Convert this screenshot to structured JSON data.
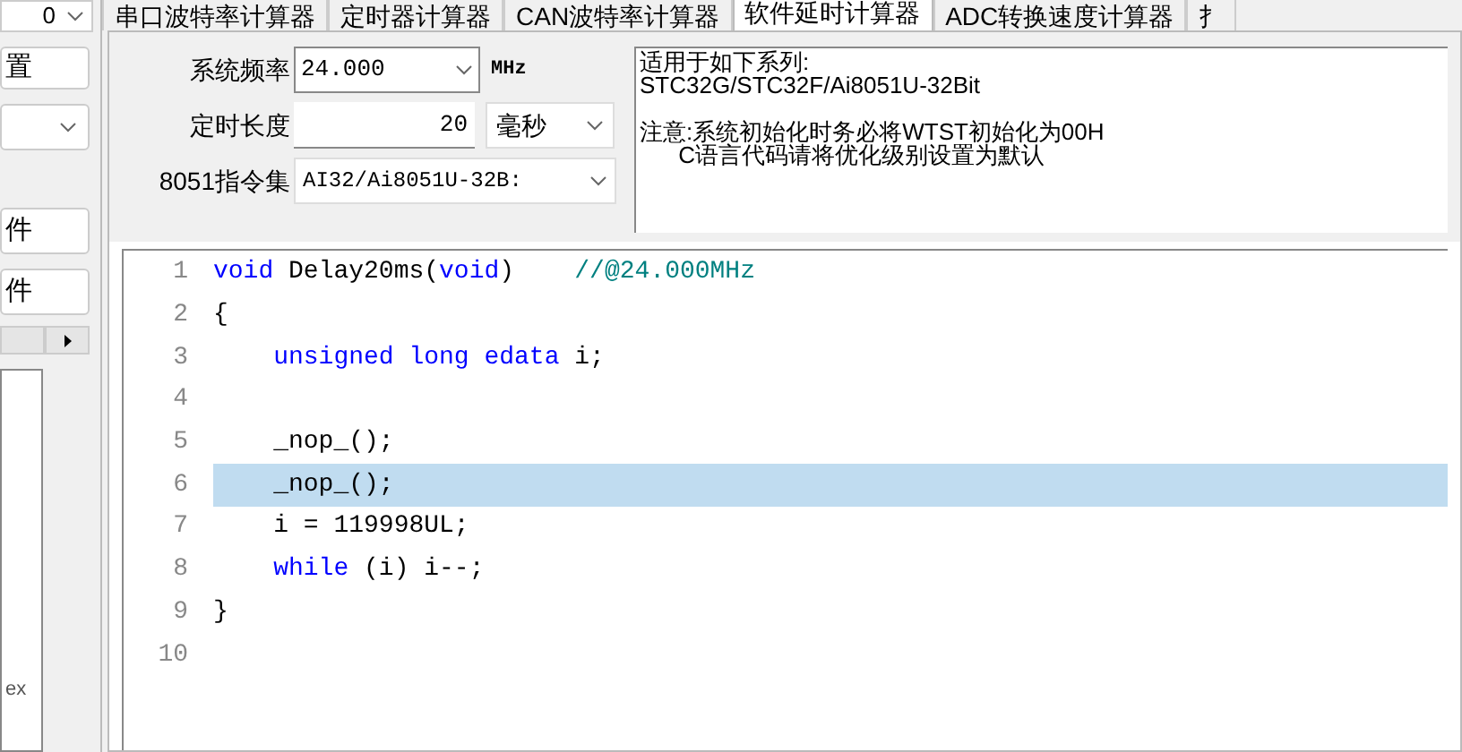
{
  "left_panel": {
    "top_dropdown": {
      "value": "0"
    },
    "buttons": [
      {
        "label": "置"
      },
      {
        "label": "件"
      },
      {
        "label": "件"
      }
    ],
    "box_text": "ex"
  },
  "tabs": [
    {
      "label": "串口波特率计算器",
      "selected": false
    },
    {
      "label": "定时器计算器",
      "selected": false
    },
    {
      "label": "CAN波特率计算器",
      "selected": false
    },
    {
      "label": "软件延时计算器",
      "selected": true
    },
    {
      "label": "ADC转换速度计算器",
      "selected": false
    },
    {
      "label": "扌",
      "selected": false
    }
  ],
  "form": {
    "frequency": {
      "label": "系统频率",
      "value": "24.000",
      "unit": "MHz"
    },
    "duration": {
      "label": "定时长度",
      "value": "20",
      "unit": "毫秒"
    },
    "instruction_set": {
      "label": "8051指令集",
      "value": "AI32/Ai8051U-32B:"
    }
  },
  "notes": {
    "series": [
      "适用于如下系列:",
      "STC32G/STC32F/Ai8051U-32Bit"
    ],
    "warning": [
      "注意:系统初始化时务必将WTST初始化为00H",
      "      C语言代码请将优化级别设置为默认"
    ]
  },
  "editor": {
    "lines": [
      {
        "number": "1",
        "selected": false,
        "tokens": [
          {
            "kind": "keyword",
            "text": "void"
          },
          {
            "kind": "plain",
            "text": " Delay20ms("
          },
          {
            "kind": "keyword",
            "text": "void"
          },
          {
            "kind": "plain",
            "text": ")    "
          },
          {
            "kind": "comment",
            "text": "//@24.000MHz"
          }
        ]
      },
      {
        "number": "2",
        "selected": false,
        "tokens": [
          {
            "kind": "plain",
            "text": "{"
          }
        ]
      },
      {
        "number": "3",
        "selected": false,
        "tokens": [
          {
            "kind": "keyword",
            "text": "    unsigned long edata"
          },
          {
            "kind": "plain",
            "text": " i;"
          }
        ]
      },
      {
        "number": "4",
        "selected": false
      },
      {
        "number": "5",
        "selected": false,
        "tokens": [
          {
            "kind": "plain",
            "text": "    _nop_();"
          }
        ]
      },
      {
        "number": "6",
        "selected": true,
        "tokens": [
          {
            "kind": "plain",
            "text": "    _nop_();"
          }
        ]
      },
      {
        "number": "7",
        "selected": false,
        "tokens": [
          {
            "kind": "plain",
            "text": "    i = 119998UL;"
          }
        ]
      },
      {
        "number": "8",
        "selected": false,
        "tokens": [
          {
            "kind": "keyword",
            "text": "    while"
          },
          {
            "kind": "plain",
            "text": " (i) i--;"
          }
        ]
      },
      {
        "number": "9",
        "selected": false,
        "tokens": [
          {
            "kind": "plain",
            "text": "}"
          }
        ]
      },
      {
        "number": "10",
        "selected": false
      }
    ]
  }
}
